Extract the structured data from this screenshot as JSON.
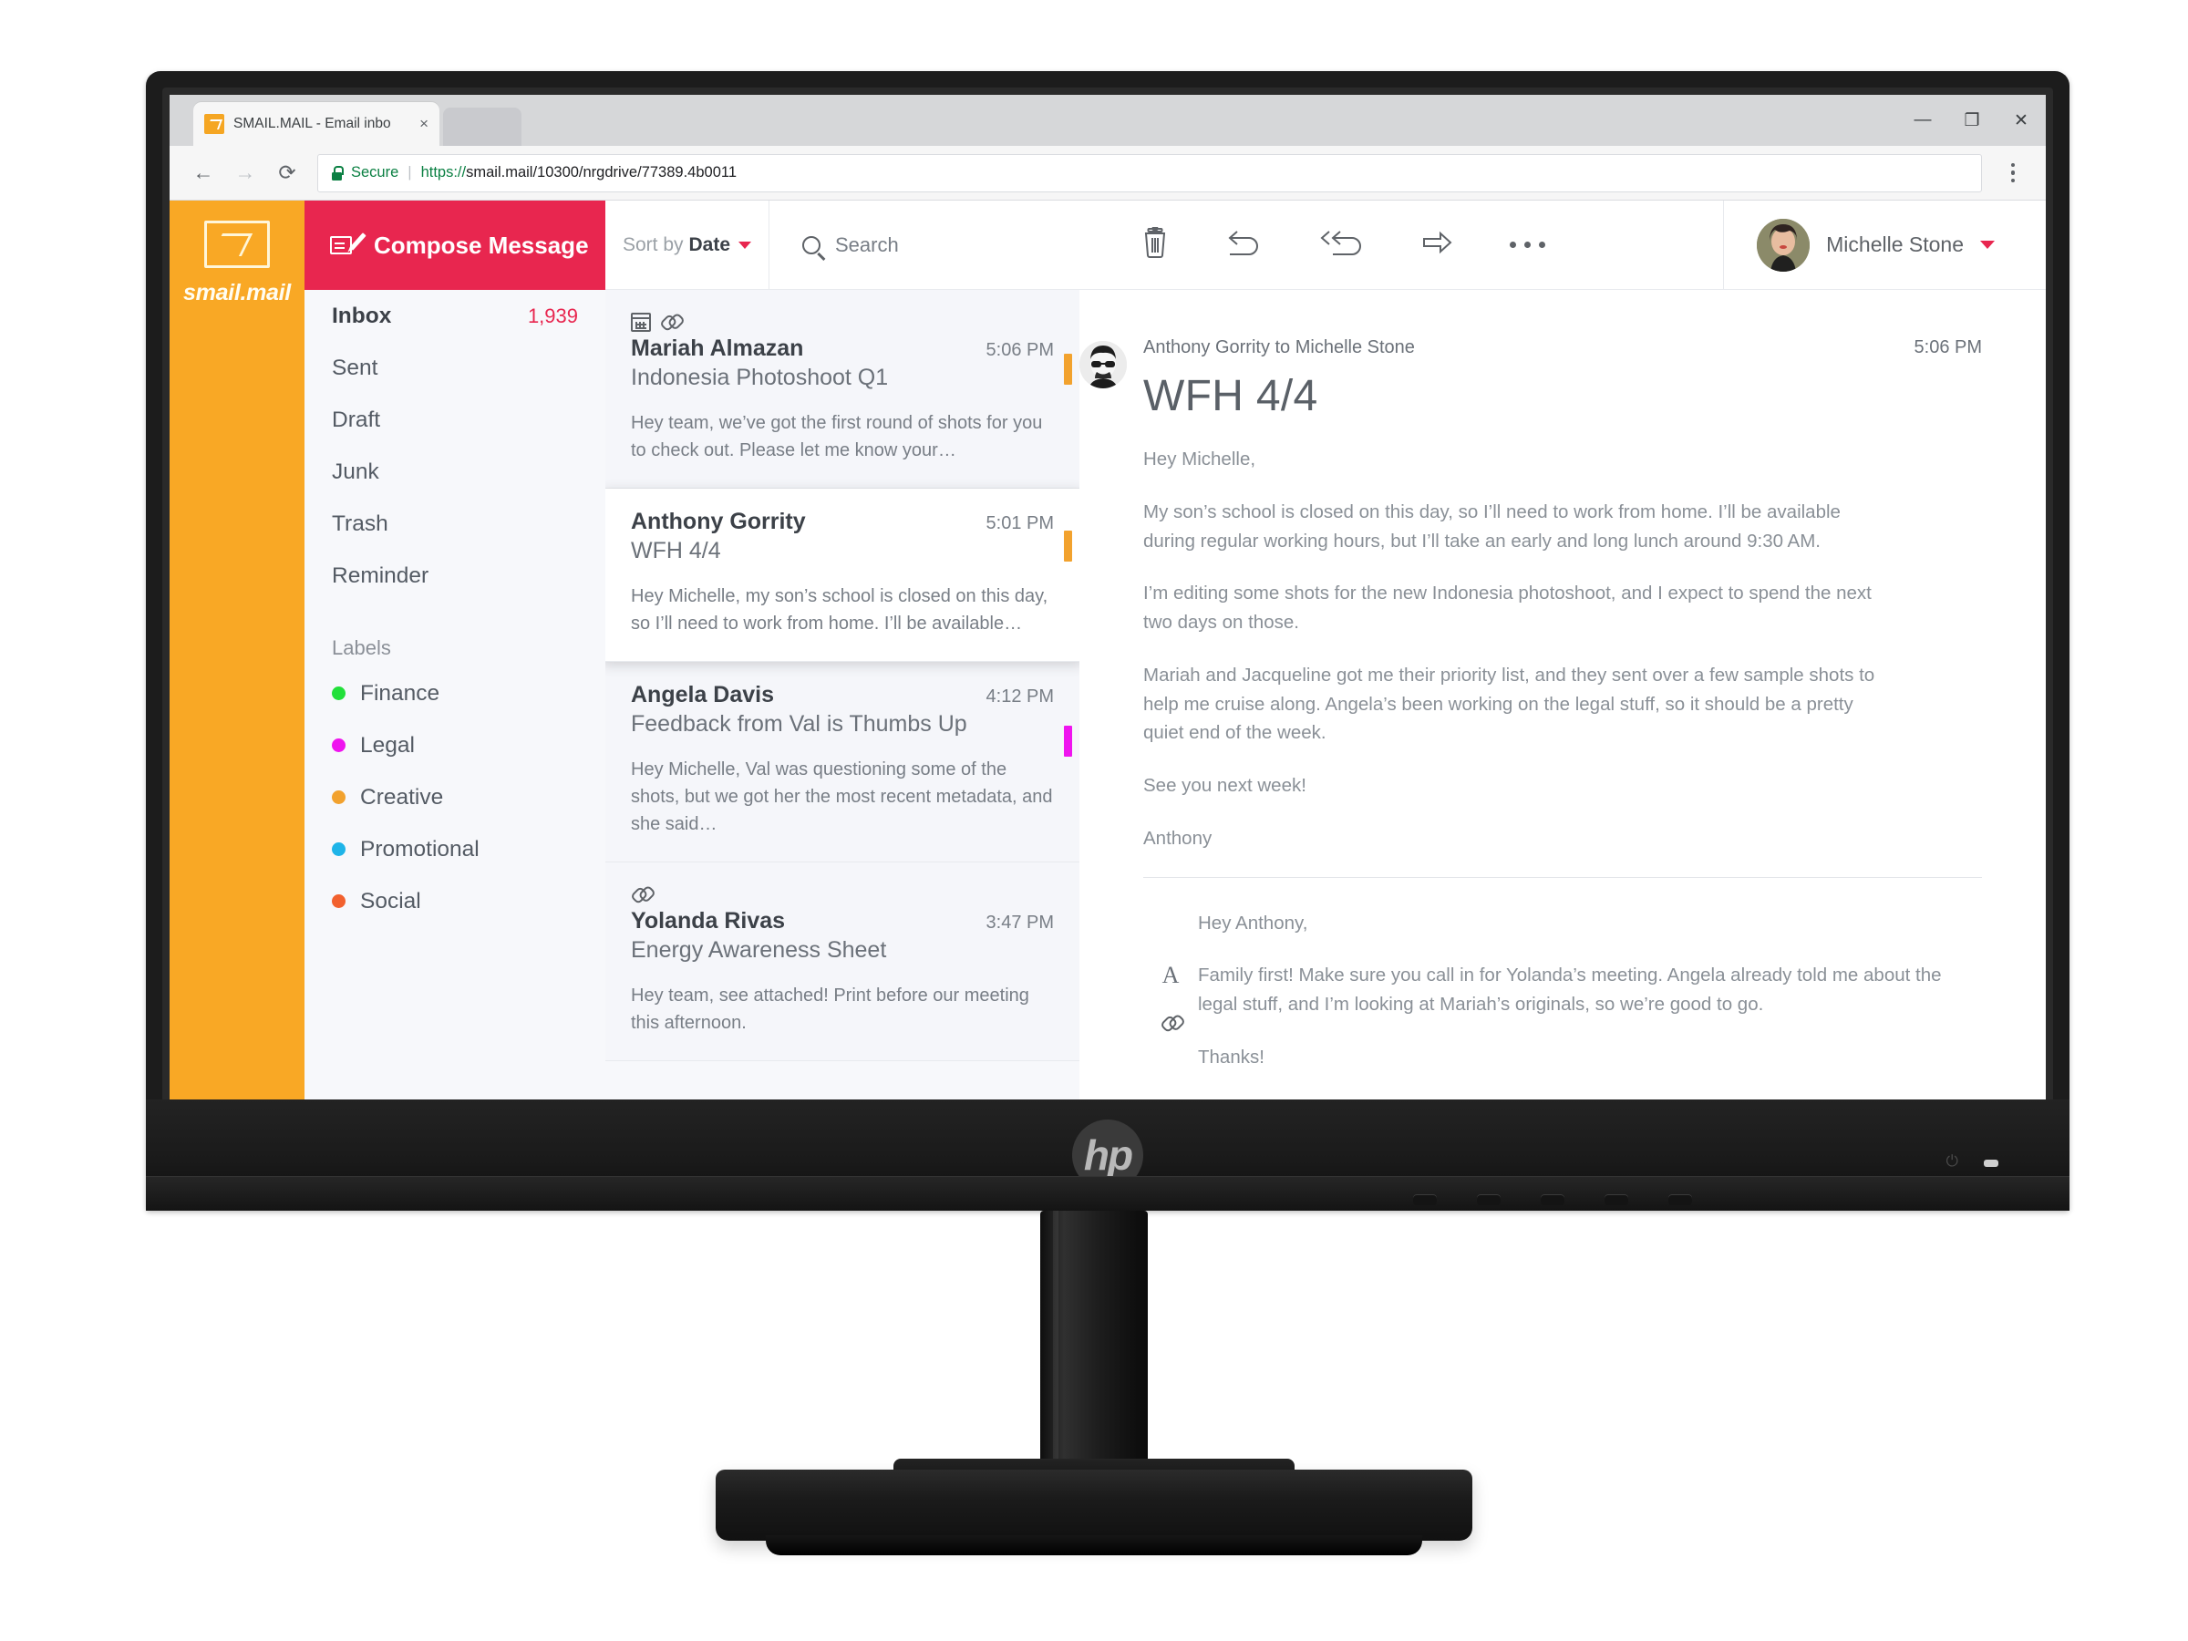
{
  "browser": {
    "tab_title": "SMAIL.MAIL - Email inbo",
    "tab_close": "×",
    "back": "←",
    "forward": "→",
    "reload": "⟳",
    "secure_label": "Secure",
    "url_scheme": "https://",
    "url_rest": "smail.mail/10300/nrgdrive/77389.4b0011",
    "minimize": "—",
    "restore": "❐",
    "close": "✕"
  },
  "brand": {
    "name": "smail.mail"
  },
  "compose": {
    "label": "Compose Message"
  },
  "folders": [
    {
      "label": "Inbox",
      "count": "1,939",
      "active": true
    },
    {
      "label": "Sent",
      "count": "",
      "active": false
    },
    {
      "label": "Draft",
      "count": "",
      "active": false
    },
    {
      "label": "Junk",
      "count": "",
      "active": false
    },
    {
      "label": "Trash",
      "count": "",
      "active": false
    },
    {
      "label": "Reminder",
      "count": "",
      "active": false
    }
  ],
  "labels_heading": "Labels",
  "labels": [
    {
      "text": "Finance",
      "color": "#22e03a"
    },
    {
      "text": "Legal",
      "color": "#ef14ef"
    },
    {
      "text": "Creative",
      "color": "#f2a22e"
    },
    {
      "text": "Promotional",
      "color": "#1eb4e8"
    },
    {
      "text": "Social",
      "color": "#f2612e"
    }
  ],
  "listhead": {
    "sort_prefix": "Sort by",
    "sort_value": "Date",
    "search_placeholder": "Search"
  },
  "toolbar": {
    "delete_title": "Delete",
    "reply_title": "Reply",
    "reply_all_title": "Reply All",
    "forward_title": "Forward",
    "more_title": "More"
  },
  "account": {
    "name": "Michelle Stone"
  },
  "mails": [
    {
      "sender": "Mariah Almazan",
      "subject": "Indonesia Photoshoot Q1",
      "time": "5:06 PM",
      "snippet": "Hey team, we’ve got the first round of shots for you to check out. Please let me know your…",
      "flag_color": "#f2a22e",
      "has_calendar": true,
      "has_attachment": true,
      "selected": false
    },
    {
      "sender": "Anthony Gorrity",
      "subject": "WFH 4/4",
      "time": "5:01 PM",
      "snippet": "Hey Michelle, my son’s school is closed on this day, so I’ll need to work from home. I’ll be available…",
      "flag_color": "#f2a22e",
      "has_calendar": false,
      "has_attachment": false,
      "selected": true
    },
    {
      "sender": "Angela Davis",
      "subject": "Feedback from Val is Thumbs Up",
      "time": "4:12 PM",
      "snippet": "Hey Michelle, Val was questioning some of the shots, but we got her the most recent metadata, and she said…",
      "flag_color": "#ef14ef",
      "has_calendar": false,
      "has_attachment": false,
      "selected": false
    },
    {
      "sender": "Yolanda Rivas",
      "subject": "Energy Awareness Sheet",
      "time": "3:47 PM",
      "snippet": "Hey team, see attached! Print before our meeting this afternoon.",
      "flag_color": "",
      "has_calendar": false,
      "has_attachment": true,
      "selected": false
    }
  ],
  "reader": {
    "from_line": "Anthony Gorrity to Michelle Stone",
    "time": "5:06 PM",
    "subject": "WFH 4/4",
    "body": [
      "Hey Michelle,",
      "My son’s school is closed on this day, so I’ll need to work from home. I’ll be available during regular working hours, but I’ll take an early and long lunch around 9:30 AM.",
      "I’m editing some shots for the new Indonesia photoshoot, and I expect to spend the next two days on those.",
      "Mariah and Jacqueline got me their priority list, and they sent over a few sample shots to help me cruise along. Angela’s been working on the legal stuff, so it should be a pretty quiet end of the week.",
      "See you next week!",
      "Anthony"
    ],
    "reply": [
      "Hey Anthony,",
      "Family first! Make sure you call in for Yolanda’s meeting. Angela already told me about the legal stuff, and I’m looking at Mariah’s originals, so we’re good to go.",
      "Thanks!"
    ],
    "format_tool": "A"
  },
  "monitor": {
    "brand": "hp"
  }
}
